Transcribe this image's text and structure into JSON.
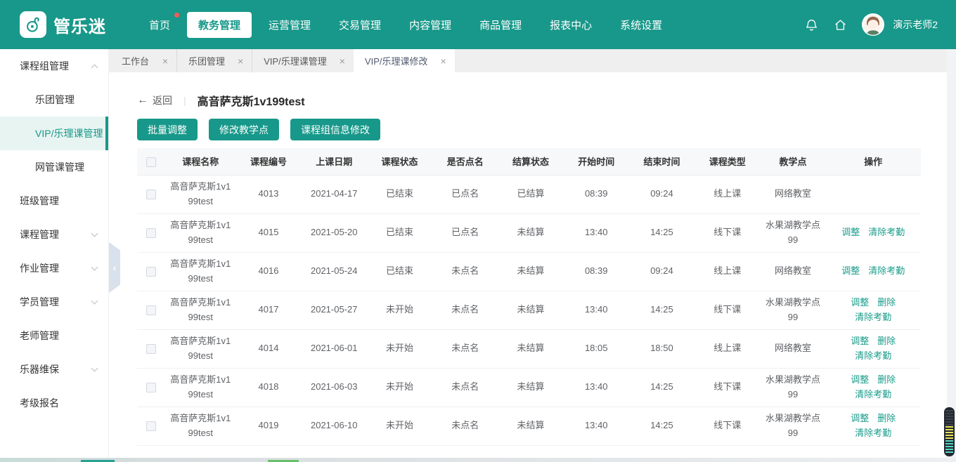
{
  "theme": {
    "teal": "#18988a",
    "link_color": "#1a9c8b",
    "badge_red": "#f25b58"
  },
  "navbar": {
    "logo_text": "管乐迷",
    "items": [
      {
        "label": "首页",
        "active": false,
        "badge": true
      },
      {
        "label": "教务管理",
        "active": true,
        "badge": false
      },
      {
        "label": "运营管理",
        "active": false,
        "badge": false
      },
      {
        "label": "交易管理",
        "active": false,
        "badge": false
      },
      {
        "label": "内容管理",
        "active": false,
        "badge": false
      },
      {
        "label": "商品管理",
        "active": false,
        "badge": false
      },
      {
        "label": "报表中心",
        "active": false,
        "badge": false
      },
      {
        "label": "系统设置",
        "active": false,
        "badge": false
      }
    ],
    "user": {
      "name": "演示老师2"
    }
  },
  "sidebar": {
    "items": [
      {
        "label": "课程组管理",
        "level": 1,
        "chevron": "up",
        "active": false
      },
      {
        "label": "乐团管理",
        "level": 2,
        "chevron": "",
        "active": false
      },
      {
        "label": "VIP/乐理课管理",
        "level": 2,
        "chevron": "",
        "active": true
      },
      {
        "label": "网管课管理",
        "level": 2,
        "chevron": "",
        "active": false
      },
      {
        "label": "班级管理",
        "level": 1,
        "chevron": "",
        "active": false
      },
      {
        "label": "课程管理",
        "level": 1,
        "chevron": "down",
        "active": false
      },
      {
        "label": "作业管理",
        "level": 1,
        "chevron": "down",
        "active": false
      },
      {
        "label": "学员管理",
        "level": 1,
        "chevron": "down",
        "active": false
      },
      {
        "label": "老师管理",
        "level": 1,
        "chevron": "",
        "active": false
      },
      {
        "label": "乐器维保",
        "level": 1,
        "chevron": "down",
        "active": false
      },
      {
        "label": "考级报名",
        "level": 1,
        "chevron": "",
        "active": false
      }
    ]
  },
  "tabs": [
    {
      "label": "工作台",
      "active": false
    },
    {
      "label": "乐团管理",
      "active": false
    },
    {
      "label": "VIP/乐理课管理",
      "active": false
    },
    {
      "label": "VIP/乐理课修改",
      "active": true
    }
  ],
  "content": {
    "back_label": "返回",
    "page_title": "高音萨克斯1v199test",
    "action_buttons": [
      {
        "label": "批量调整"
      },
      {
        "label": "修改教学点"
      },
      {
        "label": "课程组信息修改"
      }
    ],
    "table": {
      "headers": [
        "课程名称",
        "课程编号",
        "上课日期",
        "课程状态",
        "是否点名",
        "结算状态",
        "开始时间",
        "结束时间",
        "课程类型",
        "教学点",
        "操作"
      ],
      "rows": [
        {
          "name": "高音萨克斯1v199test",
          "id": "4013",
          "date": "2021-04-17",
          "status": "已结束",
          "rollcall": "已点名",
          "settle": "已结算",
          "start": "08:39",
          "end": "09:24",
          "type": "线上课",
          "site": "网络教室",
          "actions": []
        },
        {
          "name": "高音萨克斯1v199test",
          "id": "4015",
          "date": "2021-05-20",
          "status": "已结束",
          "rollcall": "已点名",
          "settle": "未结算",
          "start": "13:40",
          "end": "14:25",
          "type": "线下课",
          "site": "水果湖教学点99",
          "actions": [
            "调整",
            "清除考勤"
          ]
        },
        {
          "name": "高音萨克斯1v199test",
          "id": "4016",
          "date": "2021-05-24",
          "status": "已结束",
          "rollcall": "未点名",
          "settle": "未结算",
          "start": "08:39",
          "end": "09:24",
          "type": "线上课",
          "site": "网络教室",
          "actions": [
            "调整",
            "清除考勤"
          ]
        },
        {
          "name": "高音萨克斯1v199test",
          "id": "4017",
          "date": "2021-05-27",
          "status": "未开始",
          "rollcall": "未点名",
          "settle": "未结算",
          "start": "13:40",
          "end": "14:25",
          "type": "线下课",
          "site": "水果湖教学点99",
          "actions": [
            "调整",
            "删除",
            "清除考勤"
          ]
        },
        {
          "name": "高音萨克斯1v199test",
          "id": "4014",
          "date": "2021-06-01",
          "status": "未开始",
          "rollcall": "未点名",
          "settle": "未结算",
          "start": "18:05",
          "end": "18:50",
          "type": "线上课",
          "site": "网络教室",
          "actions": [
            "调整",
            "删除",
            "清除考勤"
          ]
        },
        {
          "name": "高音萨克斯1v199test",
          "id": "4018",
          "date": "2021-06-03",
          "status": "未开始",
          "rollcall": "未点名",
          "settle": "未结算",
          "start": "13:40",
          "end": "14:25",
          "type": "线下课",
          "site": "水果湖教学点99",
          "actions": [
            "调整",
            "删除",
            "清除考勤"
          ]
        },
        {
          "name": "高音萨克斯1v199test",
          "id": "4019",
          "date": "2021-06-10",
          "status": "未开始",
          "rollcall": "未点名",
          "settle": "未结算",
          "start": "13:40",
          "end": "14:25",
          "type": "线下课",
          "site": "水果湖教学点99",
          "actions": [
            "调整",
            "删除",
            "清除考勤"
          ]
        }
      ]
    }
  }
}
